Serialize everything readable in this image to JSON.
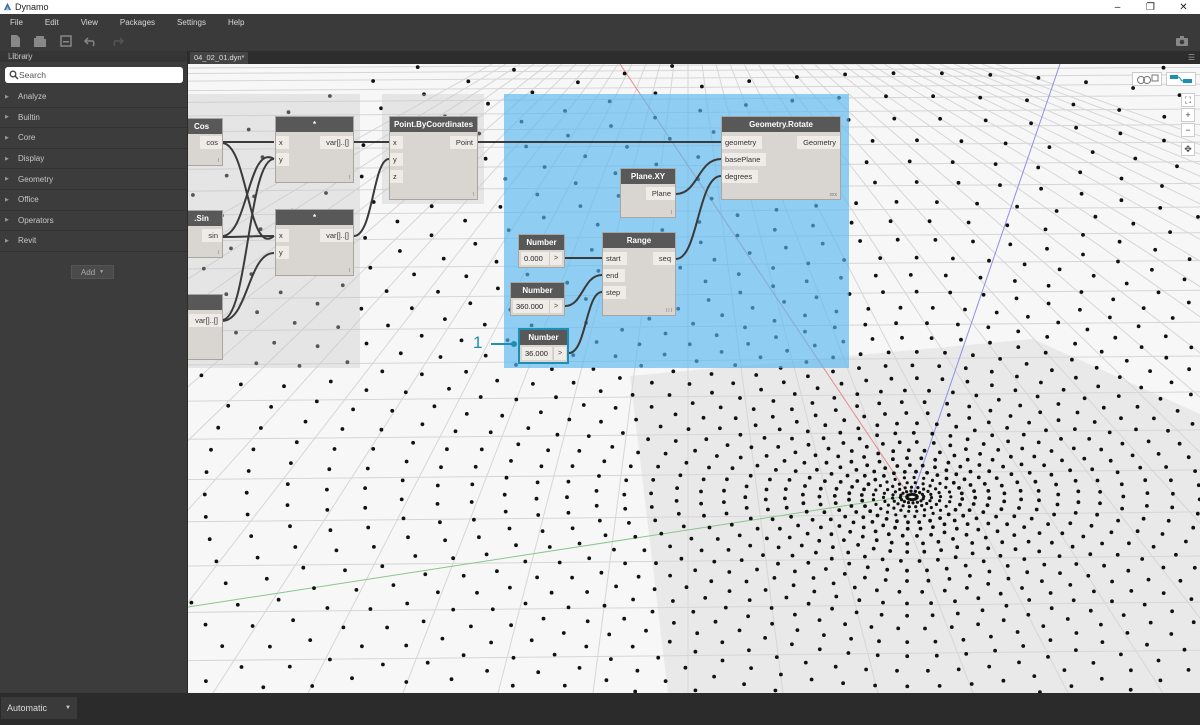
{
  "window": {
    "title": "Dynamo",
    "minimize": "–",
    "restore": "❐",
    "close": "✕"
  },
  "menu": [
    "File",
    "Edit",
    "View",
    "Packages",
    "Settings",
    "Help"
  ],
  "library": {
    "header": "Library",
    "search_placeholder": "Search",
    "items": [
      "Analyze",
      "Builtin",
      "Core",
      "Display",
      "Geometry",
      "Office",
      "Operators",
      "Revit"
    ],
    "add_label": "Add"
  },
  "tab": {
    "label": "04_02_01.dyn*"
  },
  "nodes": {
    "cos": {
      "title": "Cos",
      "out": "cos",
      "lace": "l"
    },
    "mult1": {
      "title": "*",
      "in": [
        "x",
        "y"
      ],
      "out": "var[]..[]",
      "lace": "l"
    },
    "sin": {
      "title": ".Sin",
      "out": "sin",
      "lace": "l"
    },
    "mult2": {
      "title": "*",
      "in": [
        "x",
        "y"
      ],
      "out": "var[]..[]",
      "lace": "l"
    },
    "partial": {
      "out": "var[]..[]"
    },
    "point": {
      "title": "Point.ByCoordinates",
      "in": [
        "x",
        "y",
        "z"
      ],
      "out": "Point",
      "lace": "l"
    },
    "rotate": {
      "title": "Geometry.Rotate",
      "in": [
        "geometry",
        "basePlane",
        "degrees"
      ],
      "out": "Geometry",
      "lace": "xxx"
    },
    "plane": {
      "title": "Plane.XY",
      "out": "Plane",
      "lace": "l"
    },
    "range": {
      "title": "Range",
      "in": [
        "start",
        "end",
        "step"
      ],
      "out": "seq",
      "lace": "l l l"
    },
    "num1": {
      "title": "Number",
      "value": "0.000",
      "arrow": ">"
    },
    "num2": {
      "title": "Number",
      "value": "360.000",
      "arrow": ">"
    },
    "num3": {
      "title": "Number",
      "value": "36.000",
      "arrow": ">"
    }
  },
  "callout": "1",
  "navigation": {
    "zoom_in": "+",
    "zoom_out": "−",
    "fit": "⛶",
    "pan": "✥"
  },
  "run_mode": "Automatic",
  "colors": {
    "selection": "#57b8f0",
    "callout": "#1c8fb3",
    "node_header": "#585858"
  }
}
